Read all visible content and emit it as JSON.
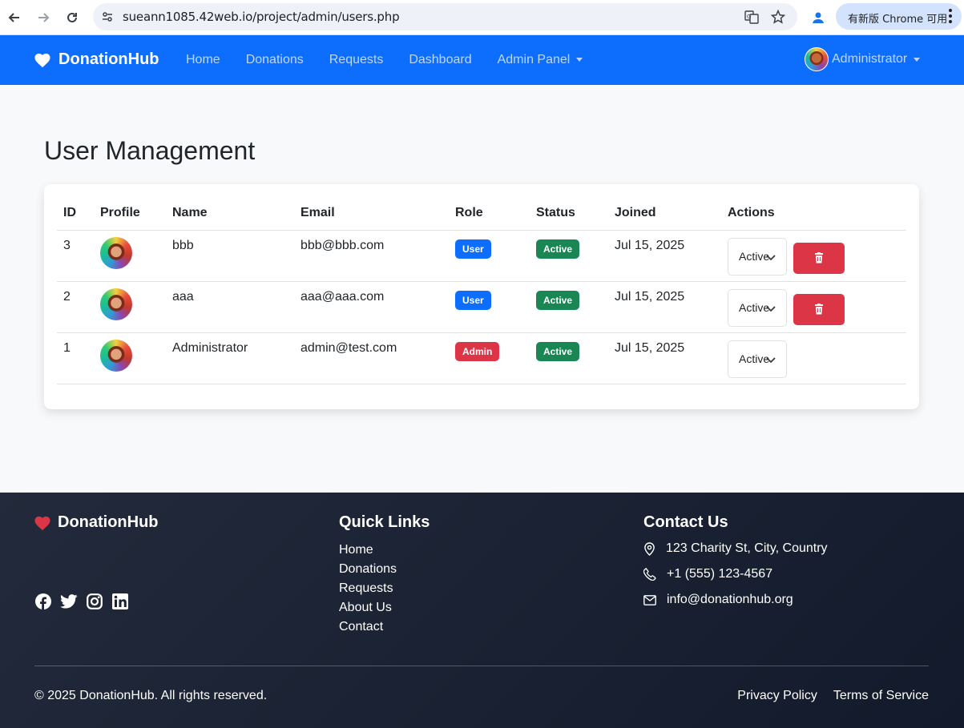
{
  "browser": {
    "url": "sueann1085.42web.io/project/admin/users.php",
    "update_label": "有新版 Chrome 可用"
  },
  "nav": {
    "brand": "DonationHub",
    "links": [
      "Home",
      "Donations",
      "Requests",
      "Dashboard"
    ],
    "admin_panel": "Admin Panel",
    "user": "Administrator"
  },
  "main": {
    "title": "User Management",
    "table": {
      "headers": [
        "ID",
        "Profile",
        "Name",
        "Email",
        "Role",
        "Status",
        "Joined",
        "Actions"
      ],
      "rows": [
        {
          "id": "3",
          "name": "bbb",
          "email": "bbb@bbb.com",
          "role": "User",
          "status": "Active",
          "joined": "Jul 15, 2025",
          "select_value": "Active",
          "deletable": true
        },
        {
          "id": "2",
          "name": "aaa",
          "email": "aaa@aaa.com",
          "role": "User",
          "status": "Active",
          "joined": "Jul 15, 2025",
          "select_value": "Active",
          "deletable": true
        },
        {
          "id": "1",
          "name": "Administrator",
          "email": "admin@test.com",
          "role": "Admin",
          "status": "Active",
          "joined": "Jul 15, 2025",
          "select_value": "Active",
          "deletable": false
        }
      ]
    }
  },
  "footer": {
    "brand": "DonationHub",
    "socials": [
      "facebook-icon",
      "twitter-icon",
      "instagram-icon",
      "linkedin-icon"
    ],
    "quick_links_title": "Quick Links",
    "quick_links": [
      "Home",
      "Donations",
      "Requests",
      "About Us",
      "Contact"
    ],
    "contact_title": "Contact Us",
    "contact": {
      "address": "123 Charity St, City, Country",
      "phone": "+1 (555) 123-4567",
      "email": "info@donationhub.org"
    },
    "copyright": "© 2025 DonationHub. All rights reserved.",
    "privacy": "Privacy Policy",
    "terms": "Terms of Service"
  },
  "colors": {
    "primary": "#0d6efd",
    "danger": "#dc3545",
    "success": "#198754",
    "footer_bg": "#1a2233"
  }
}
